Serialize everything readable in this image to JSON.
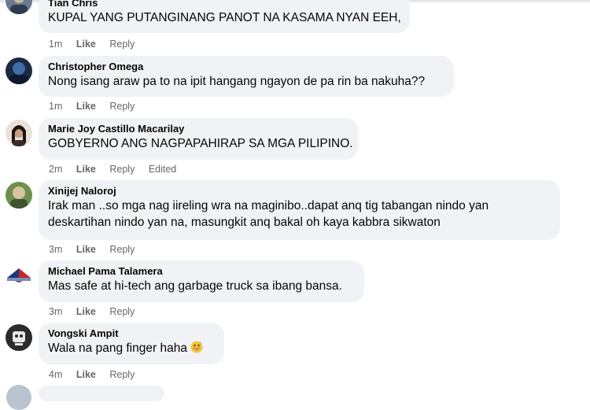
{
  "comments": [
    {
      "author": "Tian Chris",
      "text": "KUPAL YANG PUTANGINANG PANOT NA KASAMA NYAN EEH,",
      "time": "1m",
      "like": "Like",
      "reply": "Reply",
      "avatar_icon": "profile-photo"
    },
    {
      "author": "Christopher Omega",
      "text": "Nong isang araw pa to na ipit hangang ngayon de pa rin ba nakuha??",
      "time": "1m",
      "like": "Like",
      "reply": "Reply",
      "avatar_icon": "profile-photo"
    },
    {
      "author": "Marie Joy Castillo Macarilay",
      "text": "GOBYERNO ANG NAGPAPAHIRAP SA MGA PILIPINO.",
      "time": "2m",
      "like": "Like",
      "reply": "Reply",
      "edited": "Edited",
      "avatar_icon": "profile-photo"
    },
    {
      "author": "Xinijej Naloroj",
      "text_lines": [
        "Irak man ..so mga nag iireling wra na maginibo..dapat anq tig tabangan nindo yan",
        "deskartihan nindo yan na, masungkit anq bakal oh kaya kabbra sikwaton"
      ],
      "time": "3m",
      "like": "Like",
      "reply": "Reply",
      "avatar_icon": "profile-photo"
    },
    {
      "author": "Michael Pama Talamera",
      "text": "Mas safe at hi-tech ang garbage truck sa ibang bansa.",
      "time": "3m",
      "like": "Like",
      "reply": "Reply",
      "avatar_icon": "profile-photo"
    },
    {
      "author": "Vongski Ampit",
      "text": "Wala na pang finger haha",
      "emoji": "grinning-sweat-emoji",
      "time": "4m",
      "like": "Like",
      "reply": "Reply",
      "avatar_icon": "profile-photo"
    }
  ],
  "colors": {
    "bubble": "#f0f2f5",
    "text": "#050505",
    "meta": "#65676b"
  }
}
